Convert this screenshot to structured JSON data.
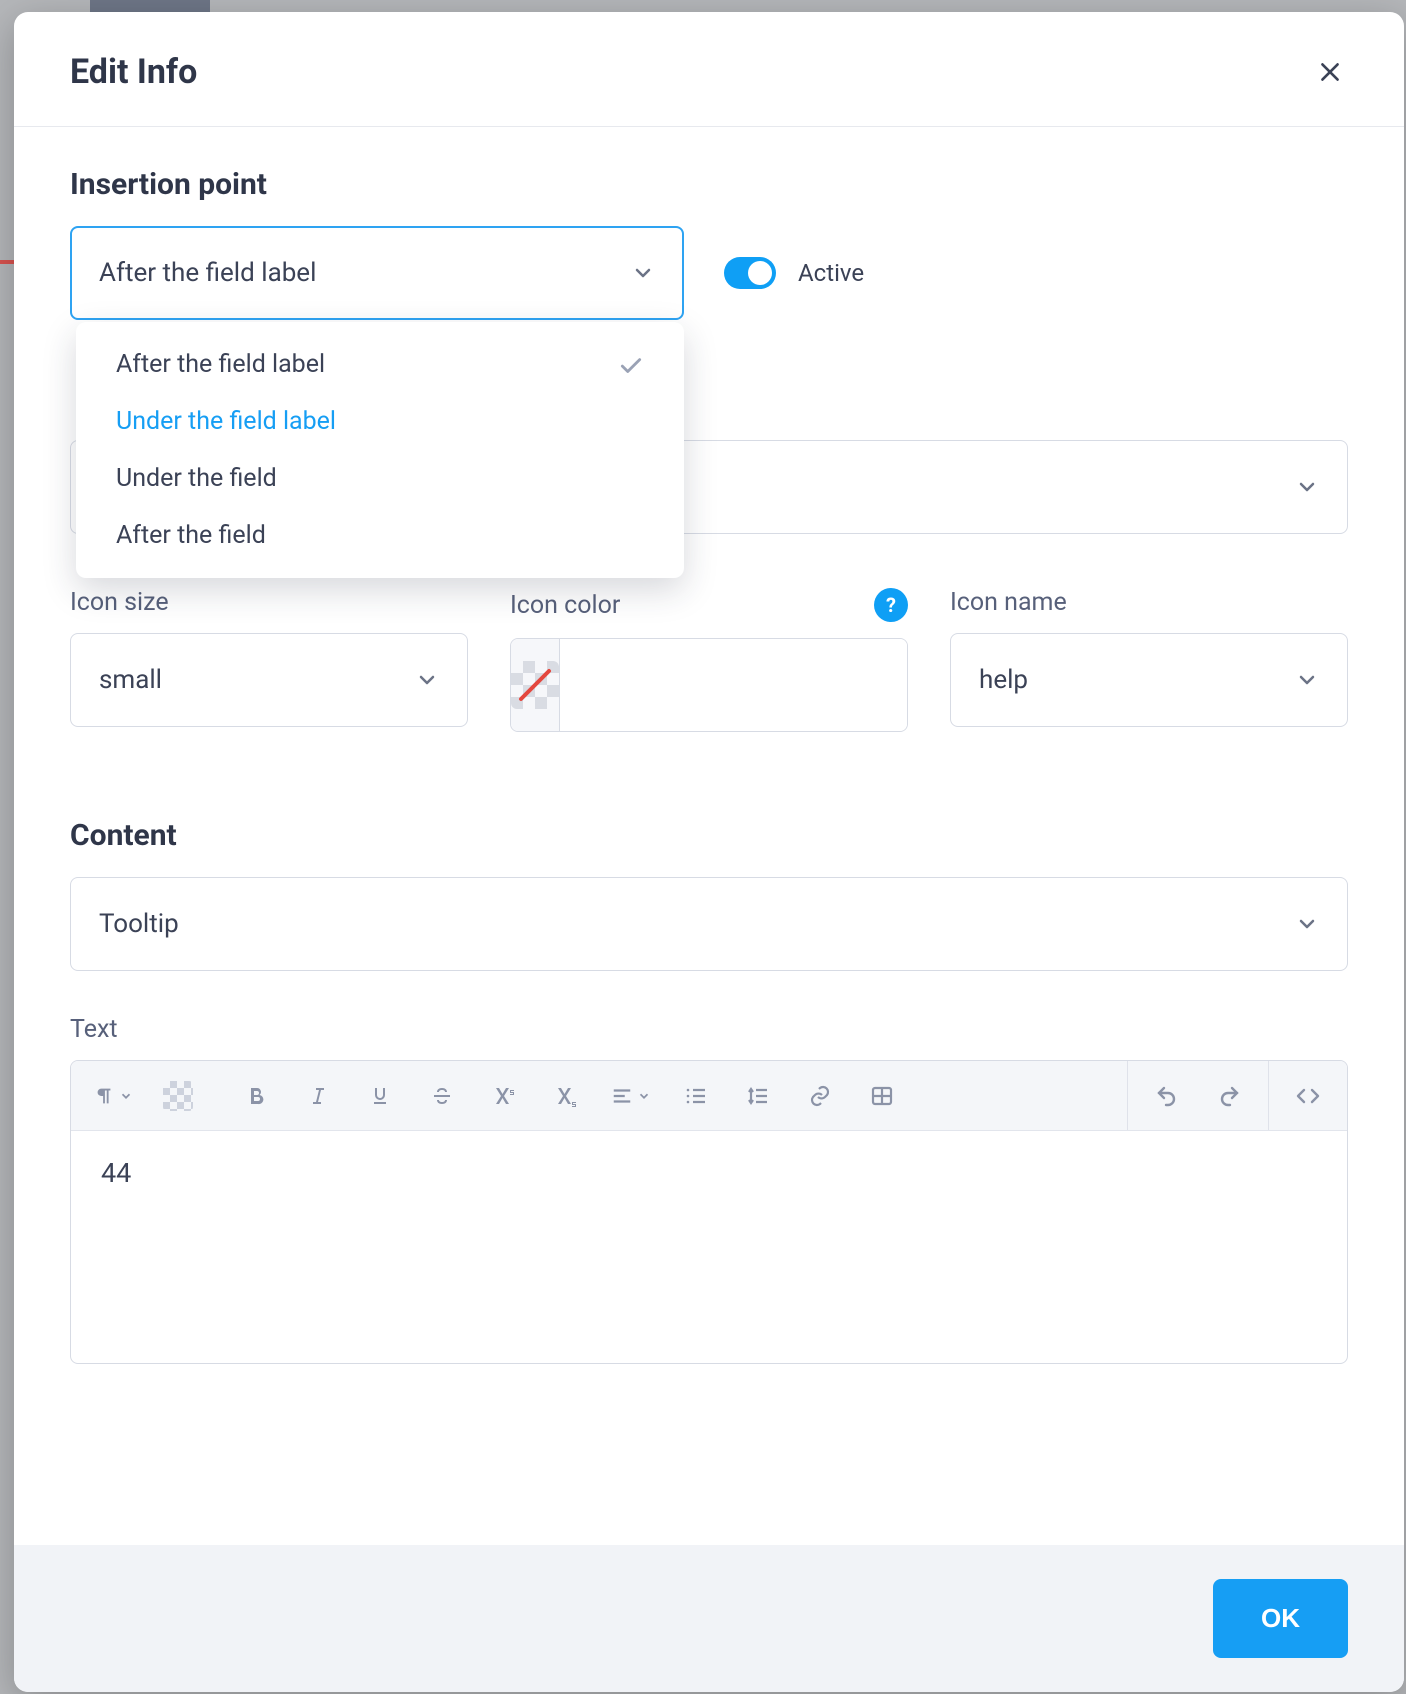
{
  "modal": {
    "title": "Edit Info",
    "ok_label": "OK"
  },
  "insertion": {
    "section_title": "Insertion point",
    "selected": "After the field label",
    "options": [
      {
        "label": "After the field label",
        "selected": true,
        "hovered": false
      },
      {
        "label": "Under the field label",
        "selected": false,
        "hovered": true
      },
      {
        "label": "Under the field",
        "selected": false,
        "hovered": false
      },
      {
        "label": "After the field",
        "selected": false,
        "hovered": false
      }
    ],
    "active_label": "Active",
    "active_on": true
  },
  "field": {
    "selected": ""
  },
  "icon": {
    "size_label": "Icon size",
    "size_value": "small",
    "color_label": "Icon color",
    "color_value": "",
    "name_label": "Icon name",
    "name_value": "help"
  },
  "content": {
    "section_title": "Content",
    "type_value": "Tooltip",
    "text_label": "Text",
    "text_value": "44"
  }
}
